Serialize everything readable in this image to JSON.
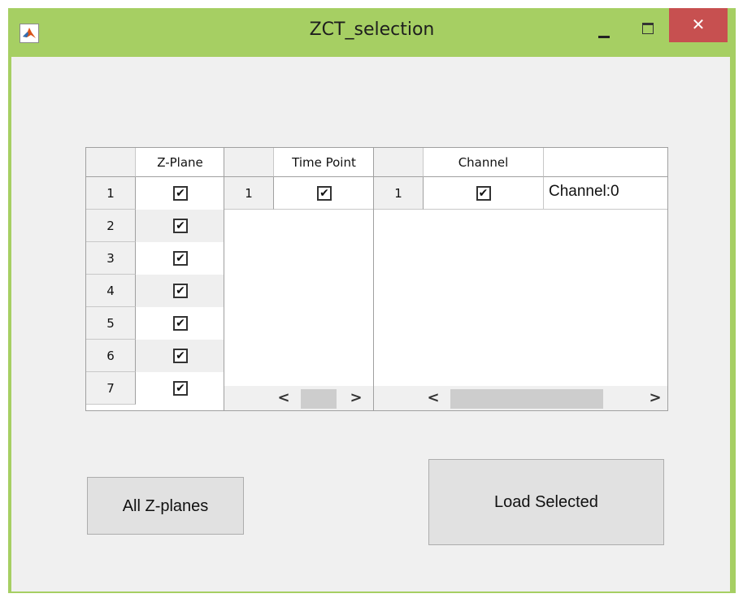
{
  "window": {
    "title": "ZCT_selection",
    "close_glyph": "✕",
    "frame_color": "#a6cf63",
    "close_color": "#c75050"
  },
  "zplane_table": {
    "header": "Z-Plane",
    "rows": [
      {
        "index": "1",
        "checked": true
      },
      {
        "index": "2",
        "checked": true
      },
      {
        "index": "3",
        "checked": true
      },
      {
        "index": "4",
        "checked": true
      },
      {
        "index": "5",
        "checked": true
      },
      {
        "index": "6",
        "checked": true
      },
      {
        "index": "7",
        "checked": true
      }
    ]
  },
  "timepoint_table": {
    "header": "Time Point",
    "rows": [
      {
        "index": "1",
        "checked": true
      }
    ],
    "scroll_left": "<",
    "scroll_right": ">"
  },
  "channel_table": {
    "header": "Channel",
    "rows": [
      {
        "index": "1",
        "checked": true,
        "name": "Channel:0"
      }
    ],
    "scroll_left": "<",
    "scroll_right": ">"
  },
  "checkbox_glyph": "✔",
  "buttons": {
    "all_zplanes": "All Z-planes",
    "load_selected": "Load Selected"
  }
}
